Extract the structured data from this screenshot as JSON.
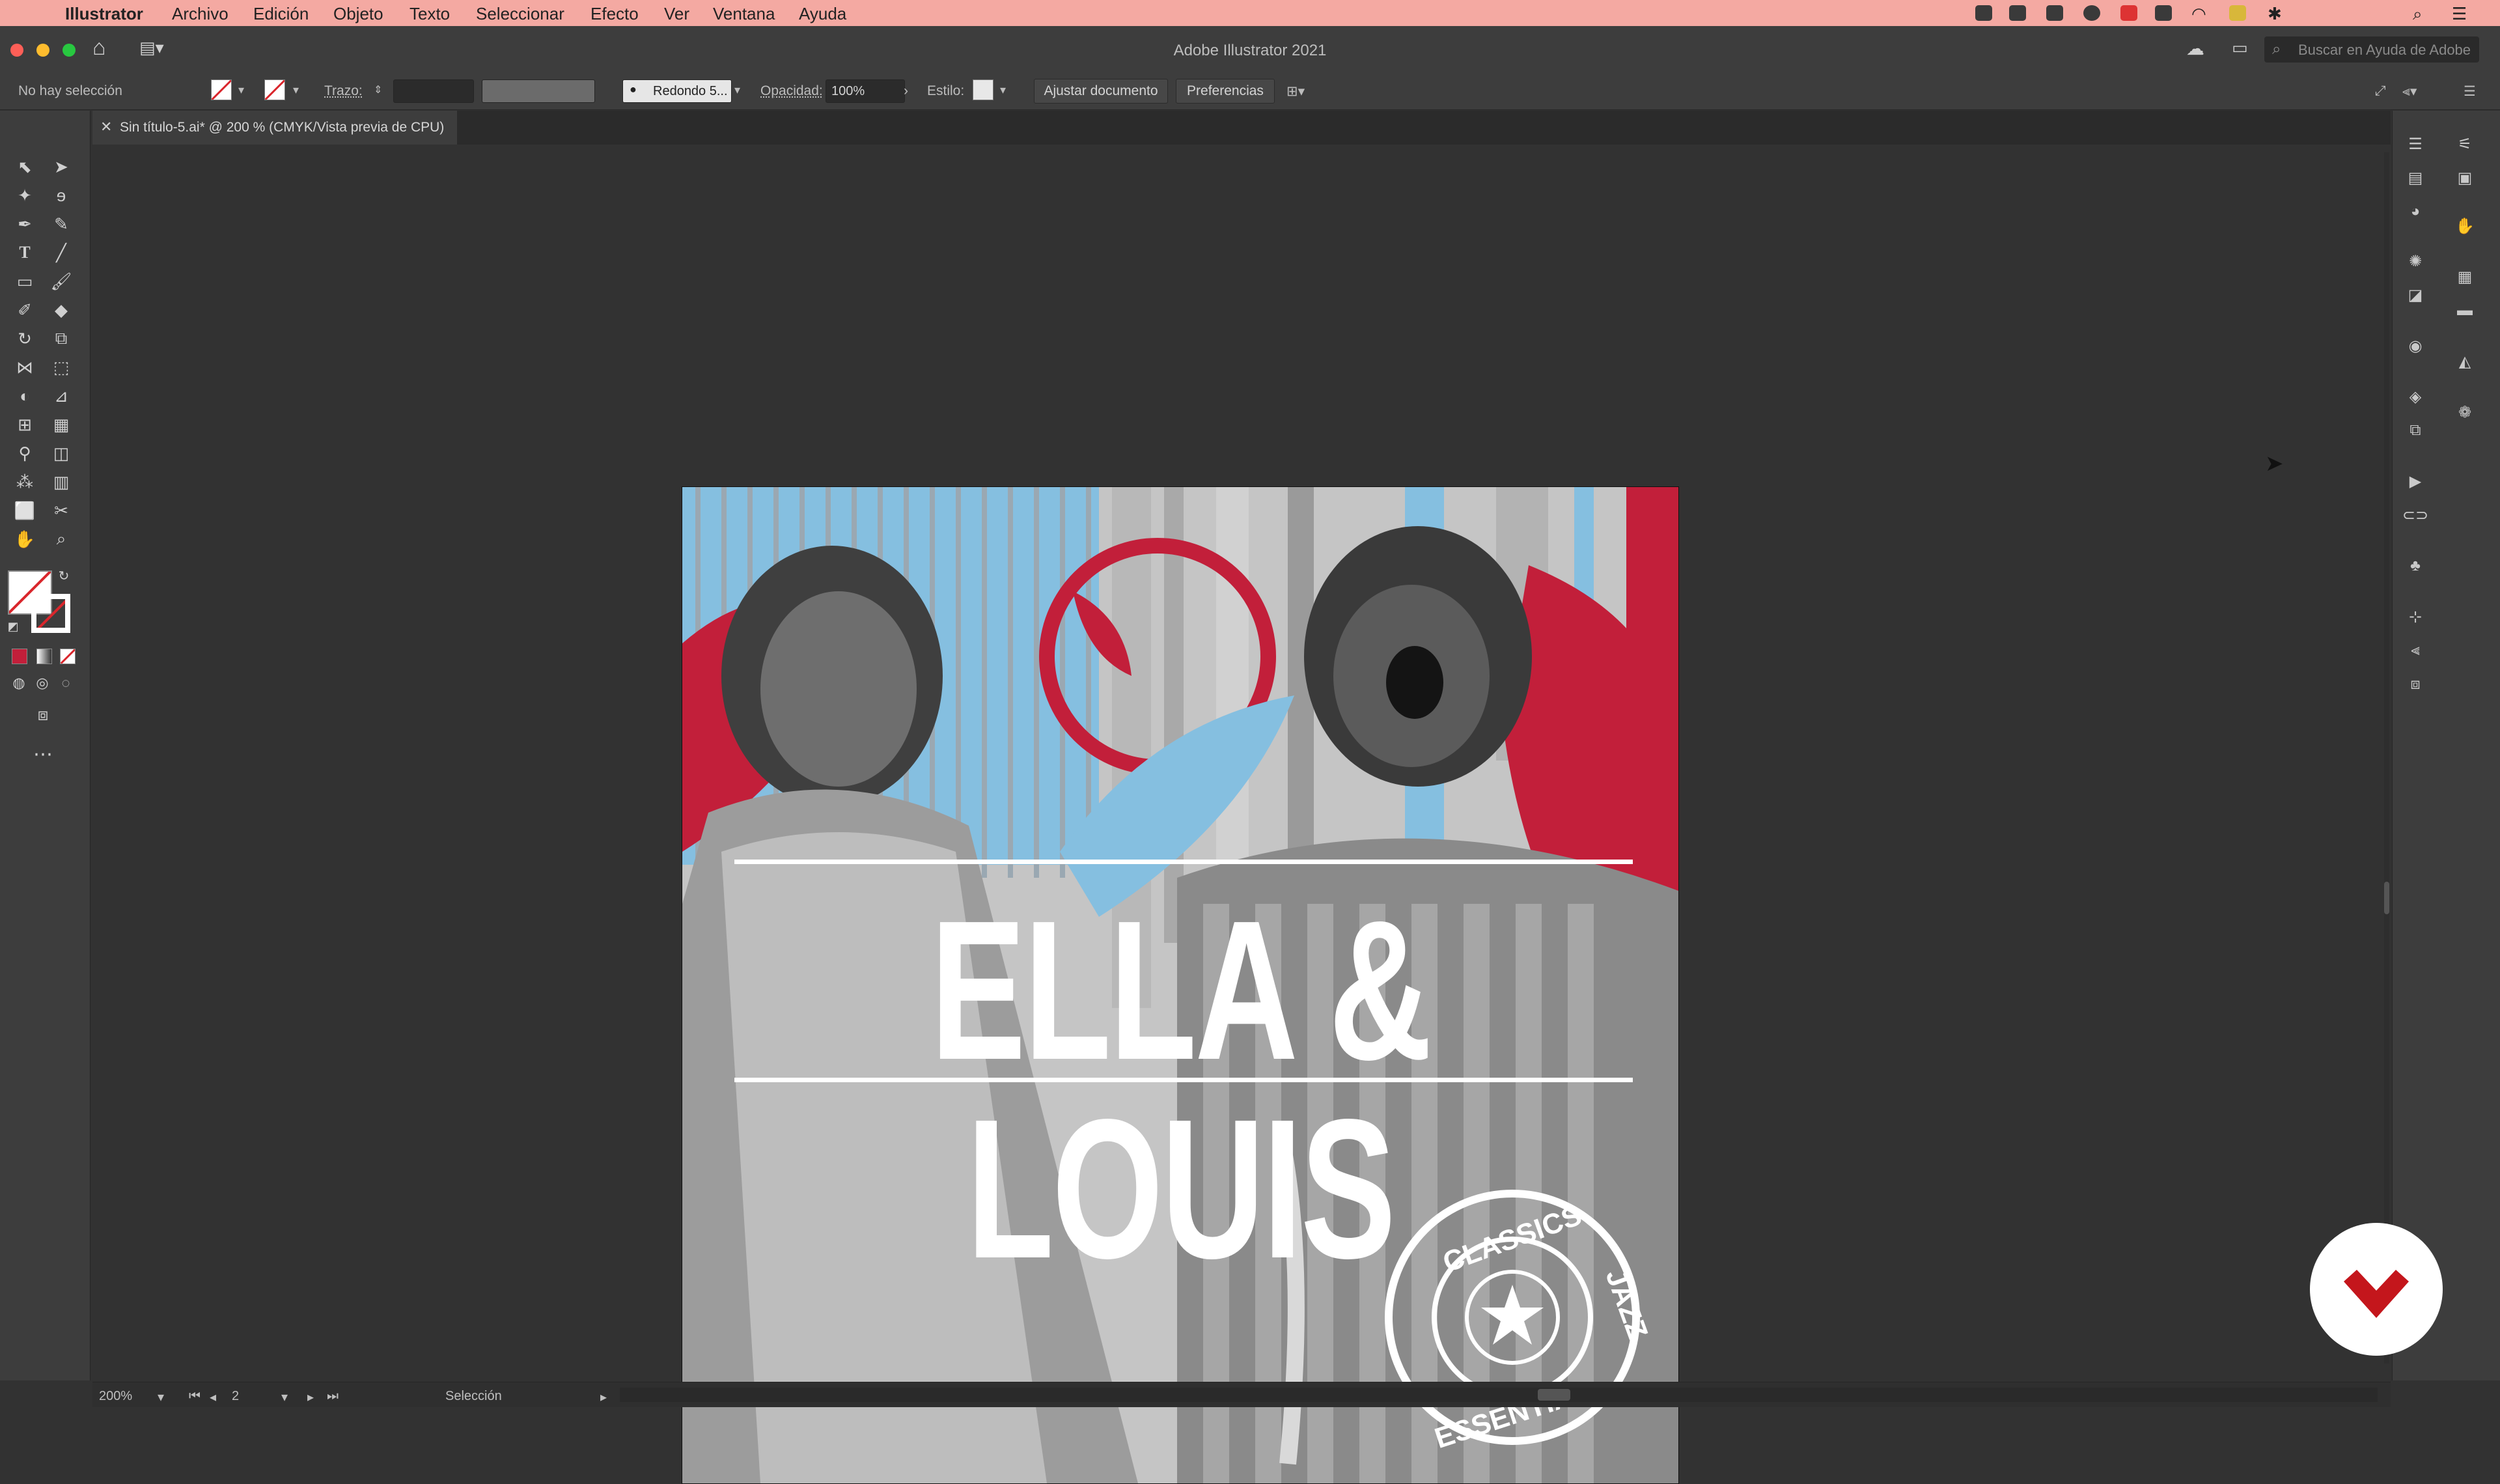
{
  "menubar": {
    "app": "Illustrator",
    "items": [
      "Archivo",
      "Edición",
      "Objeto",
      "Texto",
      "Seleccionar",
      "Efecto",
      "Ver",
      "Ventana",
      "Ayuda"
    ]
  },
  "window": {
    "title": "Adobe Illustrator 2021",
    "help_placeholder": "Buscar en Ayuda de Adobe"
  },
  "control_bar": {
    "selection_status": "No hay selección",
    "stroke_label": "Trazo:",
    "brush_label": "Redondo 5...",
    "opacity_label": "Opacidad:",
    "opacity_value": "100%",
    "style_label": "Estilo:",
    "fit_document_button": "Ajustar documento",
    "preferences_button": "Preferencias"
  },
  "document_tab": {
    "label": "Sin título-5.ai* @ 200 % (CMYK/Vista previa de CPU)"
  },
  "artwork": {
    "title": "ELLA & LOUIS",
    "stamp_top": "CLASSICS",
    "stamp_side": "JAZZ",
    "stamp_bottom": "ESSENTIAL",
    "colors": {
      "red": "#c21f3a",
      "blue": "#85bfe0",
      "gray": "#c5c5c5"
    }
  },
  "status_bar": {
    "zoom": "200%",
    "artboard_number": "2",
    "tool_status": "Selección"
  },
  "icons": {
    "toolbar": [
      "selection-tool",
      "direct-selection-tool",
      "magic-wand-tool",
      "lasso-tool",
      "pen-tool",
      "curvature-tool",
      "type-tool",
      "line-tool",
      "rectangle-tool",
      "paintbrush-tool",
      "shaper-tool",
      "eraser-tool",
      "rotate-tool",
      "scale-tool",
      "width-tool",
      "free-transform-tool",
      "shape-builder-tool",
      "perspective-grid-tool",
      "mesh-tool",
      "gradient-tool",
      "eyedropper-tool",
      "blend-tool",
      "symbol-sprayer-tool",
      "column-graph-tool",
      "artboard-tool",
      "slice-tool",
      "hand-tool",
      "zoom-tool"
    ]
  }
}
